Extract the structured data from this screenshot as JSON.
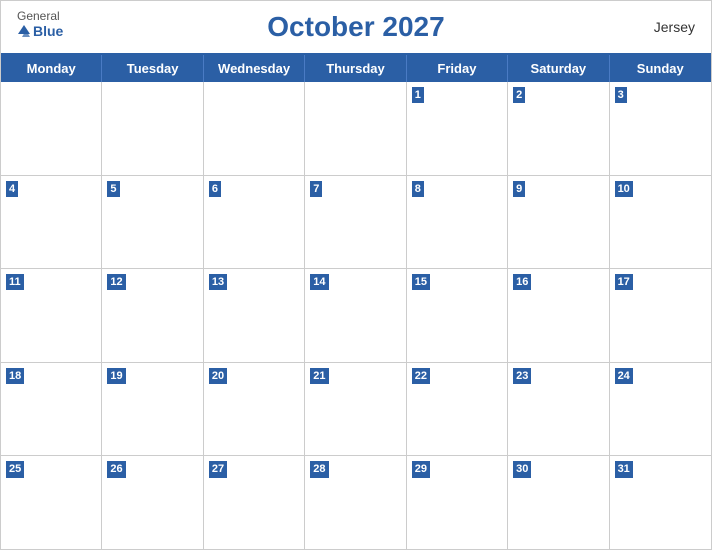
{
  "header": {
    "title": "October 2027",
    "region": "Jersey",
    "logo": {
      "general": "General",
      "blue": "Blue"
    }
  },
  "days": {
    "headers": [
      "Monday",
      "Tuesday",
      "Wednesday",
      "Thursday",
      "Friday",
      "Saturday",
      "Sunday"
    ]
  },
  "weeks": [
    [
      null,
      null,
      null,
      null,
      1,
      2,
      3
    ],
    [
      4,
      5,
      6,
      7,
      8,
      9,
      10
    ],
    [
      11,
      12,
      13,
      14,
      15,
      16,
      17
    ],
    [
      18,
      19,
      20,
      21,
      22,
      23,
      24
    ],
    [
      25,
      26,
      27,
      28,
      29,
      30,
      31
    ]
  ]
}
